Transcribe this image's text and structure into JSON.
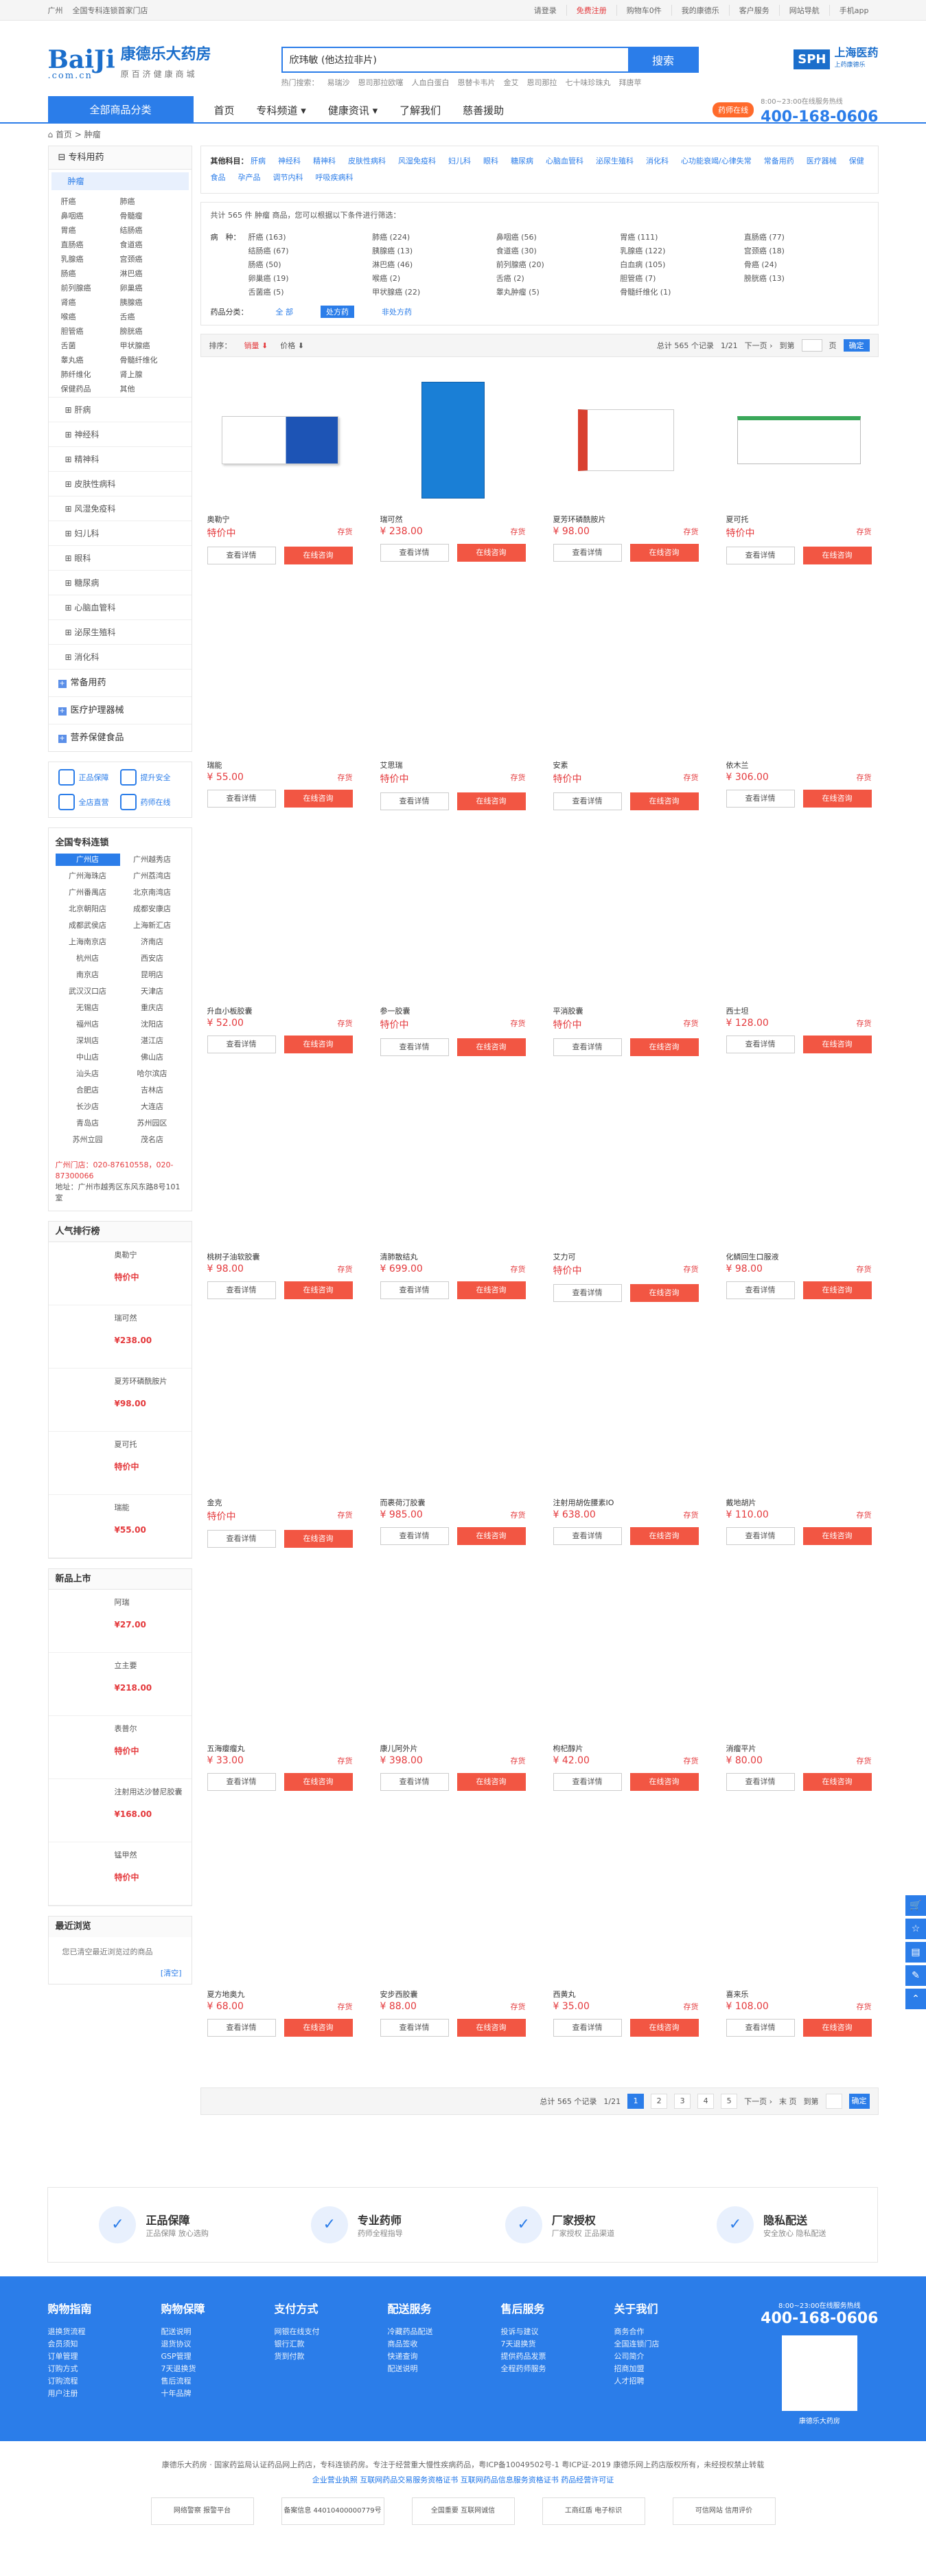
{
  "topbar": {
    "city": "广州",
    "slogan": "全国专科连锁首家门店",
    "login": "请登录",
    "register": "免费注册",
    "cart": "购物车0件",
    "mine": "我的康德乐",
    "service": "客户服务",
    "sitenav": "网站导航",
    "mobile": "手机app"
  },
  "header": {
    "logo_mark": "BaiJi",
    "logo_sub": ".com.cn",
    "logo_name": "康德乐大药房",
    "logo_tag": "原百济健康商城",
    "search_value": "欣玮敏 (他达拉非片)",
    "search_button": "搜索",
    "hot_label": "热门搜索：",
    "hot": [
      "易瑞沙",
      "恩司那拉欧噻",
      "人血白蛋白",
      "恩替卡韦片",
      "金艾",
      "恩司那拉",
      "七十味珍珠丸",
      "拜唐苹"
    ],
    "partner_logo": "SPH",
    "partner_name": "上海医药",
    "partner_sub": "上药康德乐"
  },
  "nav": {
    "allcat": "全部商品分类",
    "items": [
      "首页",
      "专科频道 ▾",
      "健康资讯 ▾",
      "了解我们",
      "慈善援助"
    ],
    "pharm": "药师在线",
    "tel": "400-168-0606",
    "tel_sub": "8:00~23:00在线服务热线"
  },
  "crumb": {
    "home": "首页",
    "current": "肿瘤"
  },
  "side": {
    "head": "专科用药",
    "active": "肿瘤",
    "subs": [
      "肝癌",
      "肺癌",
      "鼻咽癌",
      "骨髓瘤",
      "胃癌",
      "结肠癌",
      "直肠癌",
      "食道癌",
      "乳腺癌",
      "宫颈癌",
      "肠癌",
      "淋巴癌",
      "前列腺癌",
      "卵巢癌",
      "肾癌",
      "胰腺癌",
      "喉癌",
      "舌癌",
      "胆管癌",
      "膀胱癌",
      "舌菌",
      "甲状腺癌",
      "睾丸癌",
      "骨髓纤维化",
      "肺纤维化",
      "肾上腺",
      "保健药品",
      "其他"
    ],
    "cats": [
      "肝病",
      "神经科",
      "精神科",
      "皮肤性病科",
      "风湿免疫科",
      "妇儿科",
      "眼科",
      "糖尿病",
      "心脑血管科",
      "泌尿生殖科",
      "消化科"
    ],
    "top": [
      "常备用药",
      "医疗护理器械",
      "营养保健食品"
    ],
    "svc": [
      "正品保障",
      "提升安全",
      "全店直营",
      "药师在线"
    ],
    "stores_title": "全国专科连锁",
    "stores": [
      "广州店",
      "广州越秀店",
      "广州海珠店",
      "广州荔湾店",
      "广州番禺店",
      "北京南湾店",
      "北京朝阳店",
      "成都安康店",
      "成都武侯店",
      "上海新汇店",
      "上海南京店",
      "济南店",
      "杭州店",
      "西安店",
      "南京店",
      "昆明店",
      "武汉汉口店",
      "天津店",
      "无锡店",
      "重庆店",
      "福州店",
      "沈阳店",
      "深圳店",
      "湛江店",
      "中山店",
      "佛山店",
      "汕头店",
      "哈尔滨店",
      "合肥店",
      "吉林店",
      "长沙店",
      "大连店",
      "青岛店",
      "苏州园区",
      "苏州立园",
      "茂名店"
    ],
    "contact": "广州门店：020-87610558，020-87300066",
    "addr": "地址：广州市越秀区东风东路8号101室",
    "rank_title": "人气排行榜",
    "rank": [
      {
        "n": "奥勒宁",
        "p": "特价中"
      },
      {
        "n": "瑞可然",
        "p": "¥238.00"
      },
      {
        "n": "夏芳环磷酰胺片",
        "p": "¥98.00"
      },
      {
        "n": "夏可托",
        "p": "特价中"
      },
      {
        "n": "瑞能",
        "p": "¥55.00"
      }
    ],
    "new_title": "新品上市",
    "new": [
      {
        "n": "阿瑞",
        "p": "¥27.00"
      },
      {
        "n": "立主要",
        "p": "¥218.00"
      },
      {
        "n": "表普尔",
        "p": "特价中"
      },
      {
        "n": "注射用达沙替尼胶囊",
        "p": "¥168.00"
      },
      {
        "n": "锰甲然",
        "p": "特价中"
      }
    ],
    "recent_title": "最近浏览",
    "recent_text": "您已清空最近浏览过的商品",
    "recent_clear": "[清空]"
  },
  "filter": {
    "label": "其他科目：",
    "items": [
      "肝病",
      "神经科",
      "精神科",
      "皮肤性病科",
      "风湿免疫科",
      "妇儿科",
      "眼科",
      "糖尿病",
      "心脑血管科",
      "泌尿生殖科",
      "消化科",
      "心功能衰竭/心律失常",
      "常备用药",
      "医疗器械",
      "保健食品",
      "孕产品",
      "调节内科",
      "呼吸疾病科"
    ]
  },
  "result": {
    "text": "共计 565 件 肿瘤 商品，您可以根据以下条件进行筛选：",
    "disease_label": "病　种：",
    "attrs": [
      "肝癌 (163)",
      "肺癌 (224)",
      "鼻咽癌 (56)",
      "胃癌 (111)",
      "直肠癌 (77)",
      "结肠癌 (67)",
      "胰腺癌 (13)",
      "食道癌 (30)",
      "乳腺癌 (122)",
      "宫颈癌 (18)",
      "肠癌 (50)",
      "淋巴癌 (46)",
      "前列腺癌 (20)",
      "白血病 (105)",
      "骨癌 (24)",
      "卵巢癌 (19)",
      "喉癌 (2)",
      "舌癌 (2)",
      "胆管癌 (7)",
      "膀胱癌 (13)",
      "舌菌癌 (5)",
      "甲状腺癌 (22)",
      "睾丸肿瘤 (5)",
      "骨髓纤维化 (1)"
    ],
    "cls_label": "药品分类：",
    "cls": [
      "全 部",
      "处方药",
      "非处方药"
    ]
  },
  "sort": {
    "label": "排序：",
    "sales": "销量 ⬇",
    "price": "价格 ⬇",
    "total": "总计 565 个记录",
    "page": "1/21",
    "next": "下一页 ›",
    "goto": "到第",
    "pageunit": "页",
    "ok": "确定"
  },
  "products": [
    {
      "n": "奥勒宁",
      "p": "特价中"
    },
    {
      "n": "瑞可然",
      "p": "¥ 238.00"
    },
    {
      "n": "夏芳环磷酰胺片",
      "p": "¥ 98.00"
    },
    {
      "n": "夏可托",
      "p": "特价中"
    },
    {
      "n": "瑞能",
      "p": "¥ 55.00"
    },
    {
      "n": "艾思瑞",
      "p": "特价中"
    },
    {
      "n": "安素",
      "p": "特价中"
    },
    {
      "n": "依木兰",
      "p": "¥ 306.00"
    },
    {
      "n": "升血小板胶囊",
      "p": "¥ 52.00"
    },
    {
      "n": "参一胶囊",
      "p": "特价中"
    },
    {
      "n": "平消胶囊",
      "p": "特价中"
    },
    {
      "n": "西士坦",
      "p": "¥ 128.00"
    },
    {
      "n": "桃树子油软胶囊",
      "p": "¥ 98.00"
    },
    {
      "n": "清肺散结丸",
      "p": "¥ 699.00"
    },
    {
      "n": "艾力可",
      "p": "特价中"
    },
    {
      "n": "化鳞回生口服液",
      "p": "¥ 98.00"
    },
    {
      "n": "金克",
      "p": "特价中"
    },
    {
      "n": "而裹荷汀胶囊",
      "p": "¥ 985.00"
    },
    {
      "n": "注射用胡佐腰素IO",
      "p": "¥ 638.00"
    },
    {
      "n": "戴地胡片",
      "p": "¥ 110.00"
    },
    {
      "n": "五海瘿瘤丸",
      "p": "¥ 33.00"
    },
    {
      "n": "康儿阿外片",
      "p": "¥ 398.00"
    },
    {
      "n": "枸杞醇片",
      "p": "¥ 42.00"
    },
    {
      "n": "消瘤平片",
      "p": "¥ 80.00"
    },
    {
      "n": "夏方地奥九",
      "p": "¥ 68.00"
    },
    {
      "n": "安步西胶囊",
      "p": "¥ 88.00"
    },
    {
      "n": "西黄丸",
      "p": "¥ 35.00"
    },
    {
      "n": "喜来乐",
      "p": "¥ 108.00"
    }
  ],
  "card": {
    "stock": "存货",
    "detail": "查看详情",
    "consult": "在线咨询"
  },
  "pager": {
    "total": "总计 565 个记录",
    "page": "1/21",
    "pages": [
      "1",
      "2",
      "3",
      "4",
      "5"
    ],
    "next": "下一页 ›",
    "last": "末 页",
    "goto": "到第",
    "ok": "确定"
  },
  "guar": [
    {
      "t": "正品保障",
      "s": "正品保障 放心选购"
    },
    {
      "t": "专业药师",
      "s": "药师全程指导"
    },
    {
      "t": "厂家授权",
      "s": "厂家授权 正品渠道"
    },
    {
      "t": "隐私配送",
      "s": "安全放心 隐私配送"
    }
  ],
  "footer": {
    "cols": [
      {
        "h": "购物指南",
        "i": [
          "退换货流程",
          "会员须知",
          "订单管理",
          "订购方式",
          "订购流程",
          "用户注册"
        ]
      },
      {
        "h": "购物保障",
        "i": [
          "配送说明",
          "退货协议",
          "GSP管理",
          "7天退换货",
          "售后流程",
          "十年品牌"
        ]
      },
      {
        "h": "支付方式",
        "i": [
          "网银在线支付",
          "银行汇款",
          "货到付款"
        ]
      },
      {
        "h": "配送服务",
        "i": [
          "冷藏药品配送",
          "商品签收",
          "快递查询",
          "配送说明"
        ]
      },
      {
        "h": "售后服务",
        "i": [
          "投诉与建议",
          "7天退换货",
          "提供药品发票",
          "全程药师服务"
        ]
      },
      {
        "h": "关于我们",
        "i": [
          "商务合作",
          "全国连锁门店",
          "公司简介",
          "招商加盟",
          "人才招聘"
        ]
      }
    ],
    "tel": "400-168-0606",
    "tel_sub": "8:00~23:00在线服务热线",
    "qr_label": "康德乐大药房"
  },
  "bottom": {
    "l1": "康德乐大药房 · 国家药监局认证药品网上药店，专科连锁药房。专注于经营重大慢性疾病药品，粤ICP备10049502号-1 粤ICP证-2019 康德乐网上药店版权所有，未经授权禁止转载",
    "l2": "企业营业执照   互联网药品交易服务资格证书   互联网药品信息服务资格证书   药品经营许可证",
    "badges": [
      "网络警察 报警平台",
      "备案信息 44010400000779号",
      "全国重要 互联网诚信",
      "工商红盾 电子标识",
      "可信网站 信用评价"
    ]
  }
}
